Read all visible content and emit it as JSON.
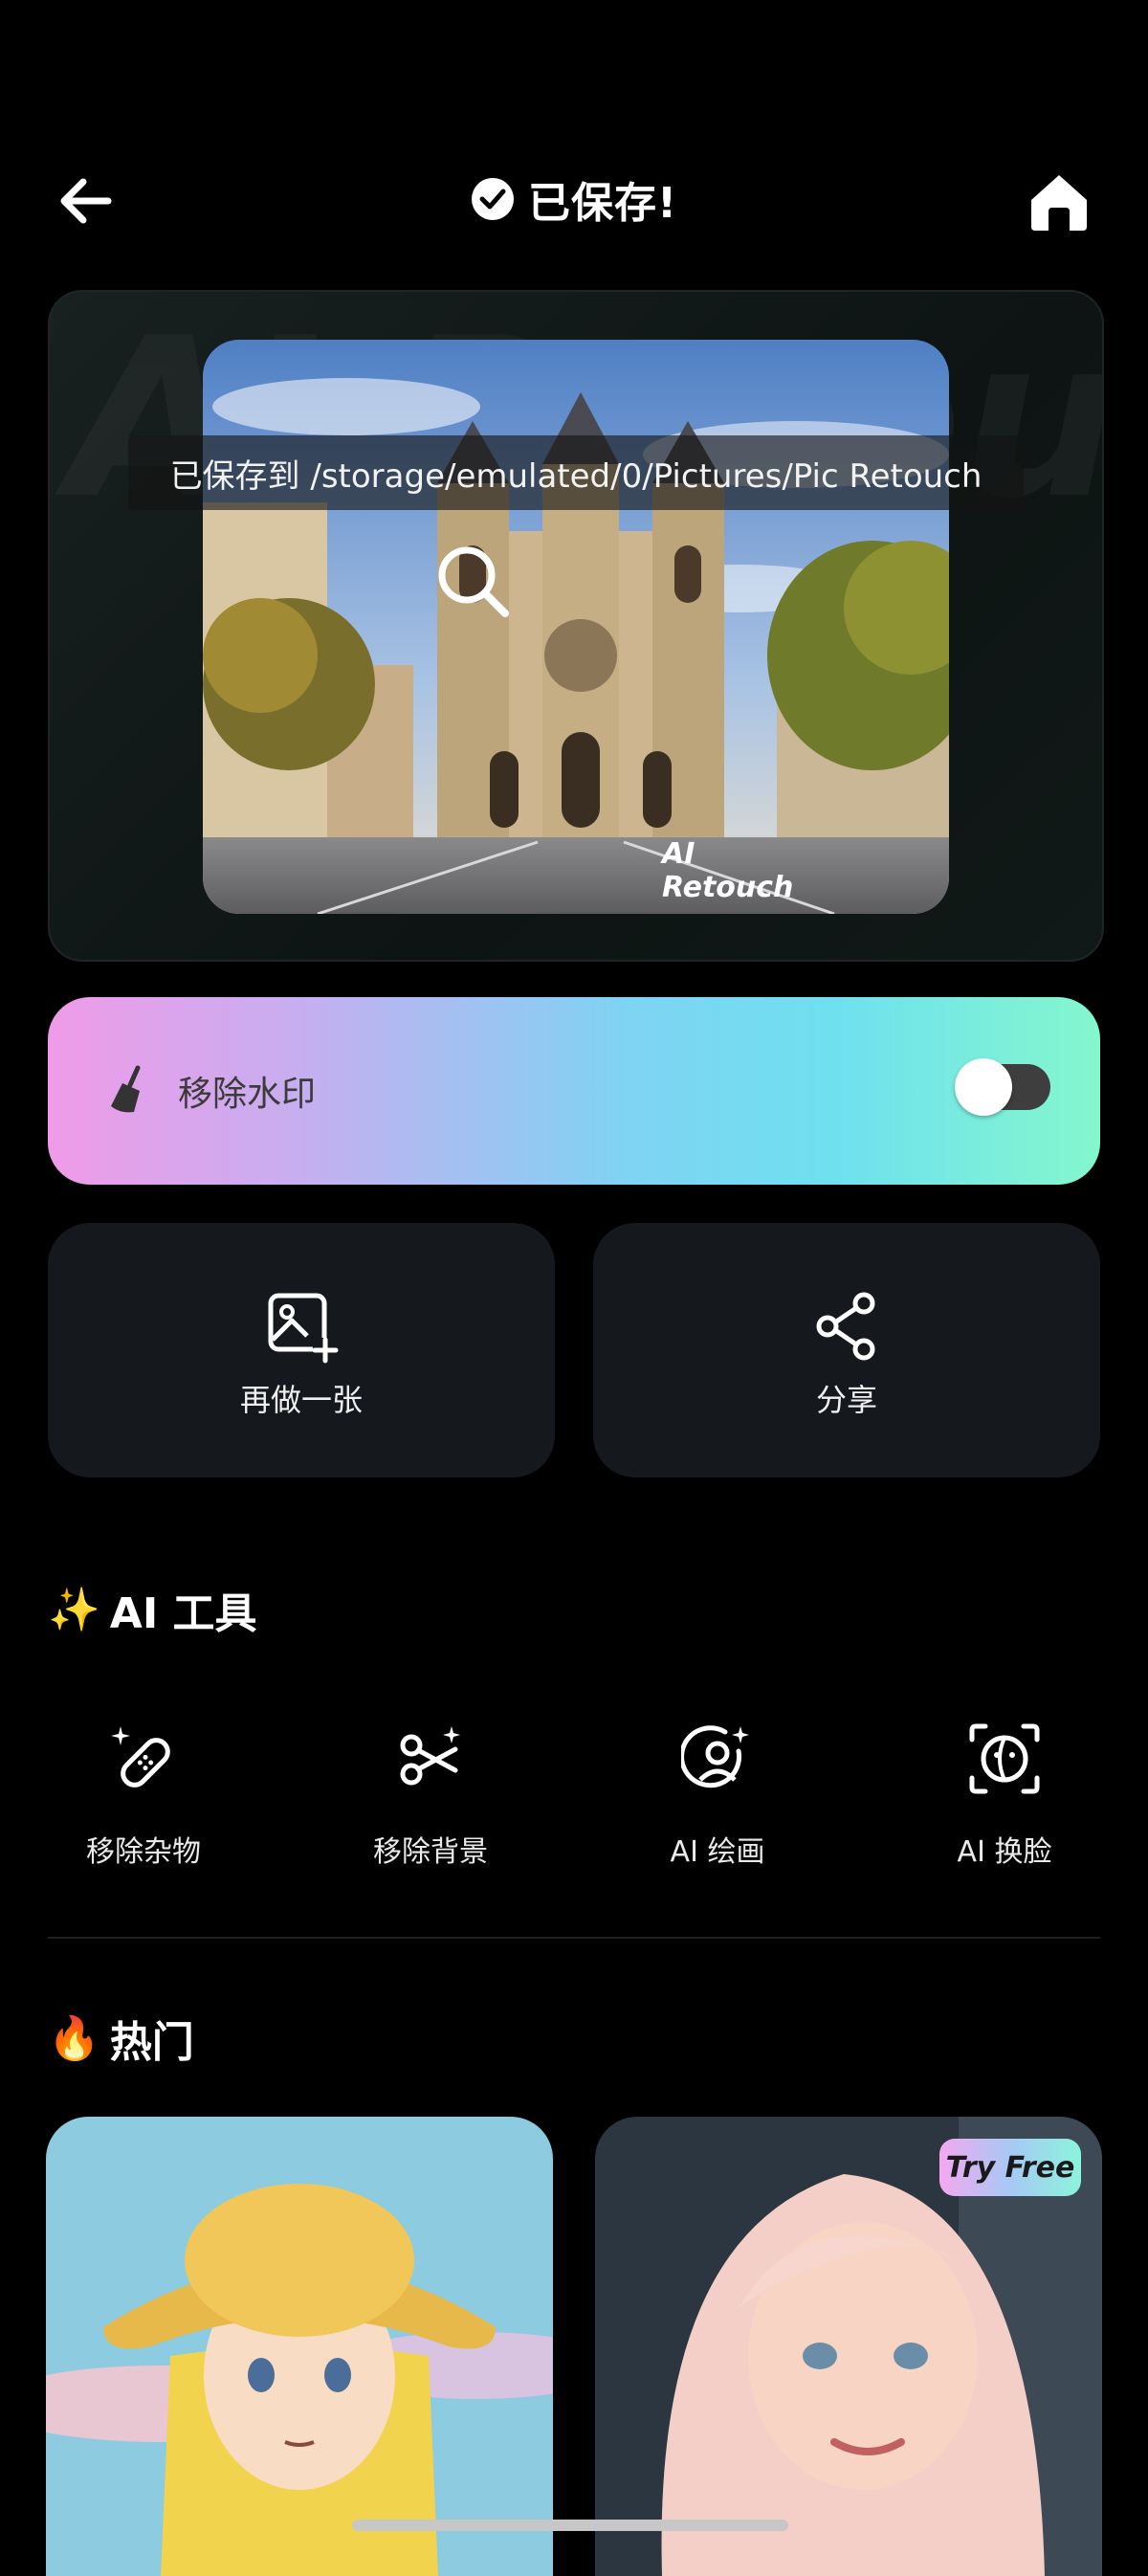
{
  "header": {
    "title": "已保存!",
    "back_icon": "arrow-left-icon",
    "home_icon": "home-icon"
  },
  "preview": {
    "saved_path_text": "已保存到 /storage/emulated/0/Pictures/Pic Retouch",
    "watermark_badge": "AI Retouch",
    "background_watermark": "AI Retouch"
  },
  "watermark_toggle": {
    "label": "移除水印",
    "enabled": false
  },
  "actions": [
    {
      "label": "再做一张",
      "icon": "add-image-icon"
    },
    {
      "label": "分享",
      "icon": "share-icon"
    }
  ],
  "ai_tools": {
    "emoji": "✨",
    "title": "AI 工具",
    "items": [
      {
        "label": "移除杂物",
        "icon": "bandage-sparkle-icon"
      },
      {
        "label": "移除背景",
        "icon": "scissors-sparkle-icon"
      },
      {
        "label": "AI 绘画",
        "icon": "user-sparkle-icon"
      },
      {
        "label": "AI 换脸",
        "icon": "face-swap-icon"
      }
    ]
  },
  "hot": {
    "emoji": "🔥",
    "title": "热门",
    "badge": "Try Free"
  },
  "colors": {
    "background": "#000000",
    "card": "#15181d",
    "gradient_start": "#f09be8",
    "gradient_end": "#84f7cd"
  }
}
